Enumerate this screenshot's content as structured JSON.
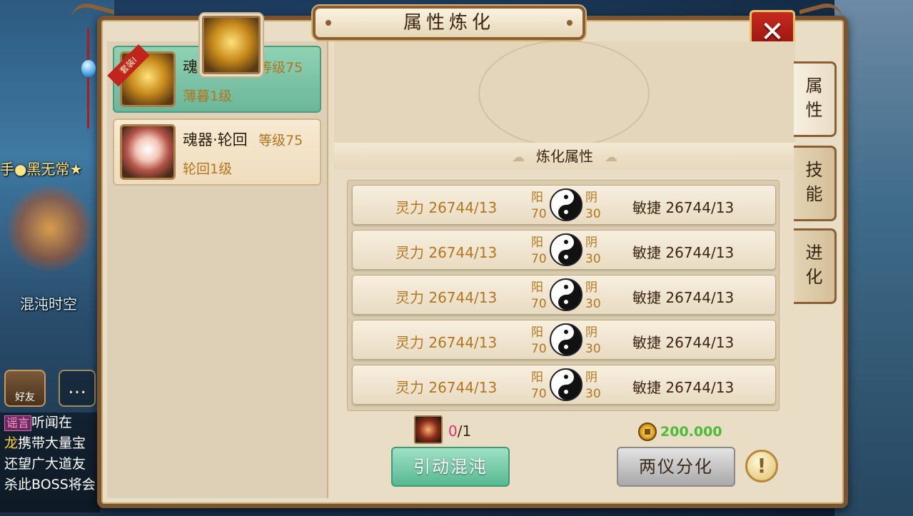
{
  "window": {
    "title": "属性炼化",
    "close_label": "✕"
  },
  "background": {
    "npc_name": "手●黑无常★",
    "zone_name": "混沌时空",
    "friend_label": "好友",
    "chat_icon": "…",
    "chat_lines": [
      {
        "tag": "谣言",
        "text": "听闻在",
        "highlight": ""
      },
      {
        "tag": "",
        "text": "携带大量宝",
        "highlight": "龙"
      },
      {
        "tag": "",
        "text": "还望广大道友",
        "highlight": ""
      },
      {
        "tag": "",
        "text": "杀此BOSS将会",
        "highlight": ""
      }
    ]
  },
  "items": [
    {
      "name": "魂器·薄暮",
      "level": "等级75",
      "sub": "薄暮1级",
      "ribbon": "套装I",
      "selected": true
    },
    {
      "name": "魂器·轮回",
      "level": "等级75",
      "sub": "轮回1级",
      "ribbon": "",
      "selected": false
    }
  ],
  "section_title": "炼化属性",
  "rows": [
    {
      "left": "灵力 26744/13",
      "yang": "阳",
      "yang_val": "70",
      "yin": "阴",
      "yin_val": "30",
      "right": "敏捷 26744/13"
    },
    {
      "left": "灵力 26744/13",
      "yang": "阳",
      "yang_val": "70",
      "yin": "阴",
      "yin_val": "30",
      "right": "敏捷 26744/13"
    },
    {
      "left": "灵力 26744/13",
      "yang": "阳",
      "yang_val": "70",
      "yin": "阴",
      "yin_val": "30",
      "right": "敏捷 26744/13"
    },
    {
      "left": "灵力 26744/13",
      "yang": "阳",
      "yang_val": "70",
      "yin": "阴",
      "yin_val": "30",
      "right": "敏捷 26744/13"
    },
    {
      "left": "灵力 26744/13",
      "yang": "阳",
      "yang_val": "70",
      "yin": "阴",
      "yin_val": "30",
      "right": "敏捷 26744/13"
    }
  ],
  "cost": {
    "have": "0",
    "need": "/1",
    "gold": "200.000"
  },
  "buttons": {
    "invoke": "引动混沌",
    "split": "两仪分化",
    "info": "!"
  },
  "tabs": [
    {
      "label1": "属",
      "label2": "性",
      "active": true
    },
    {
      "label1": "技",
      "label2": "能",
      "active": false
    },
    {
      "label1": "进",
      "label2": "化",
      "active": false
    }
  ],
  "colors": {
    "accent_green": "#57b991",
    "gold_text": "#b3761f",
    "close_red": "#c7291f",
    "frame_brown": "#7a5532"
  }
}
